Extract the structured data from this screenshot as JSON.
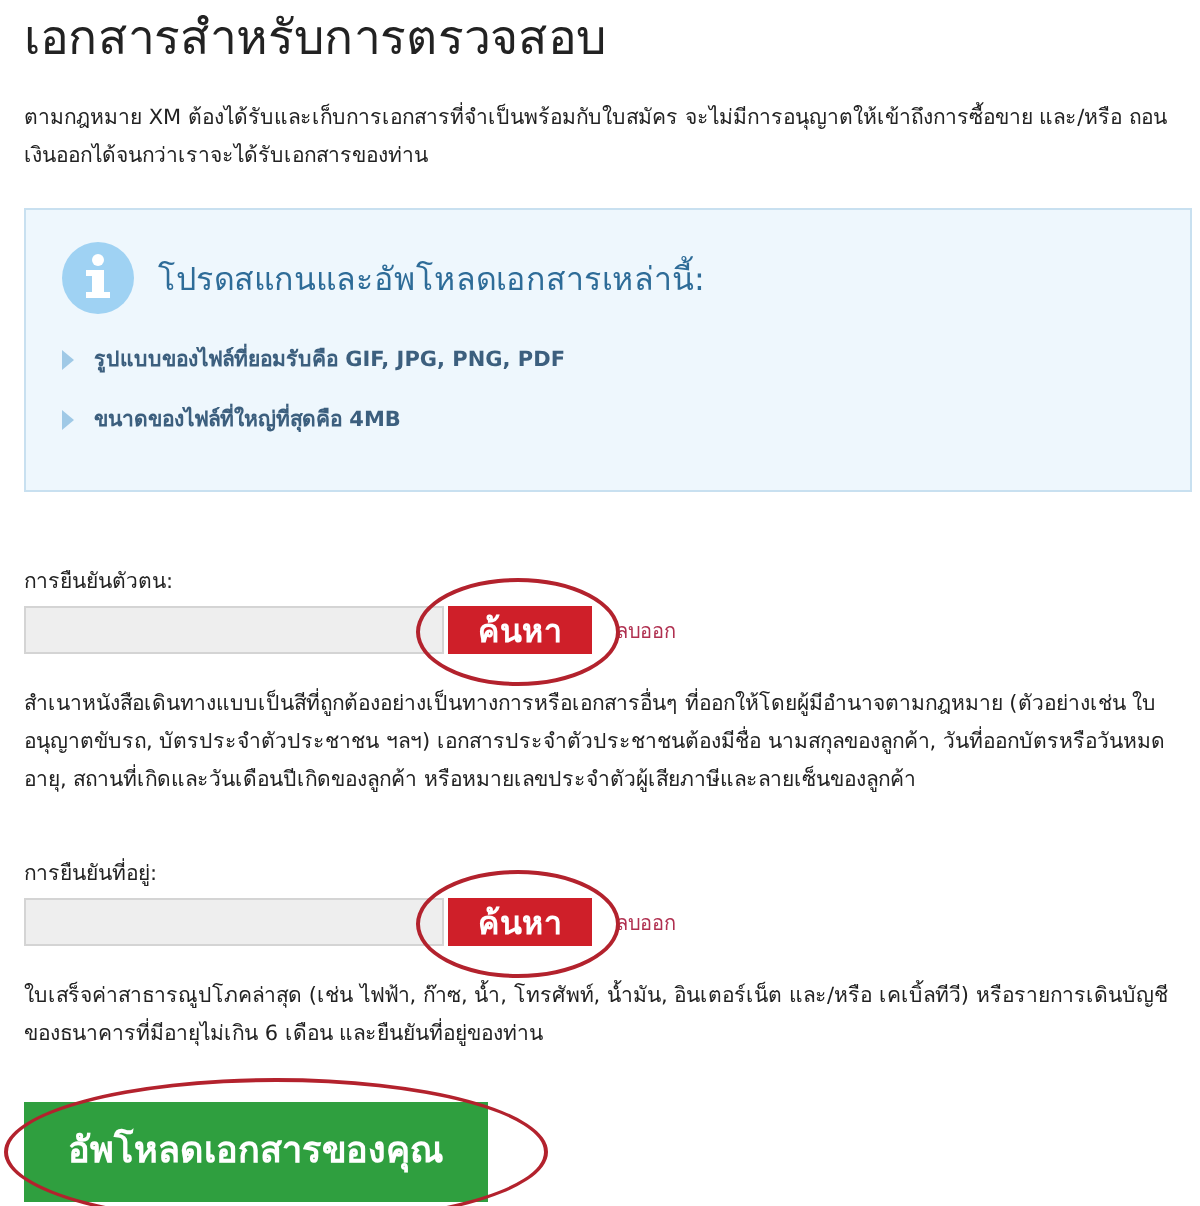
{
  "title": "เอกสารสำหรับการตรวจสอบ",
  "intro": "ตามกฎหมาย XM ต้องได้รับและเก็บการเอกสารที่จำเป็นพร้อมกับใบสมัคร จะไม่มีการอนุญาตให้เข้าถึงการซื้อขาย และ/หรือ ถอนเงินออกได้จนกว่าเราจะได้รับเอกสารของท่าน",
  "info_box": {
    "heading": "โปรดสแกนและอัพโหลดเอกสารเหล่านี้:",
    "items": [
      "รูปแบบของไฟล์ที่ยอมรับคือ GIF, JPG, PNG, PDF",
      "ขนาดของไฟล์ที่ใหญ่ที่สุดคือ 4MB"
    ]
  },
  "uploads": [
    {
      "label": "การยืนยันตัวตน:",
      "button": "ค้นหา",
      "remove_link": "ลบออก",
      "circled": true,
      "description": "สำเนาหนังสือเดินทางแบบเป็นสีที่ถูกต้องอย่างเป็นทางการหรือเอกสารอื่นๆ ที่ออกให้โดยผู้มีอำนาจตามกฎหมาย (ตัวอย่างเช่น ใบอนุญาตขับรถ, บัตรประจำตัวประชาชน ฯลฯ) เอกสารประจำตัวประชาชนต้องมีชื่อ นามสกุลของลูกค้า, วันที่ออกบัตรหรือวันหมดอายุ, สถานที่เกิดและวันเดือนปีเกิดของลูกค้า หรือหมายเลขประจำตัวผู้เสียภาษีและลายเซ็นของลูกค้า"
    },
    {
      "label": "การยืนยันที่อยู่:",
      "button": "ค้นหา",
      "remove_link": "ลบออก",
      "circled": true,
      "description": "ใบเสร็จค่าสาธารณูปโภคล่าสุด (เช่น ไฟฟ้า, ก๊าซ, น้ำ, โทรศัพท์, น้ำมัน, อินเตอร์เน็ต และ/หรือ เคเบิ้ลทีวี) หรือรายการเดินบัญชีของธนาคารที่มีอายุไม่เกิน 6 เดือน และยืนยันที่อยู่ของท่าน"
    }
  ],
  "submit": {
    "label": "อัพโหลดเอกสารของคุณ",
    "circled": true
  }
}
